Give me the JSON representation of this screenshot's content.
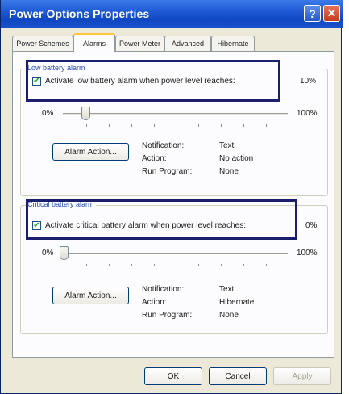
{
  "window": {
    "title": "Power Options Properties",
    "help_glyph": "?",
    "close_glyph": "✕"
  },
  "tabs": [
    {
      "label": "Power Schemes"
    },
    {
      "label": "Alarms"
    },
    {
      "label": "Power Meter"
    },
    {
      "label": "Advanced"
    },
    {
      "label": "Hibernate"
    }
  ],
  "low_alarm": {
    "group_title": "Low battery alarm",
    "checkbox_label": "Activate low battery alarm when power level reaches:",
    "checked": true,
    "level_text": "10%",
    "level_fraction": 0.1,
    "min_label": "0%",
    "max_label": "100%",
    "button_label": "Alarm Action...",
    "info_labels": [
      "Notification:",
      "Action:",
      "Run Program:"
    ],
    "info_values": [
      "Text",
      "No action",
      "None"
    ]
  },
  "critical_alarm": {
    "group_title": "Critical battery alarm",
    "checkbox_label": "Activate critical battery alarm when power level reaches:",
    "checked": true,
    "level_text": "0%",
    "level_fraction": 0.0,
    "min_label": "0%",
    "max_label": "100%",
    "button_label": "Alarm Action...",
    "info_labels": [
      "Notification:",
      "Action:",
      "Run Program:"
    ],
    "info_values": [
      "Text",
      "Hibernate",
      "None"
    ]
  },
  "buttons": {
    "ok": "OK",
    "cancel": "Cancel",
    "apply": "Apply"
  },
  "colors": {
    "titlebar": "#1f5ad4",
    "highlight_box": "#1b1e6b",
    "group_title": "#2a4db8",
    "checkmark": "#21a121"
  }
}
